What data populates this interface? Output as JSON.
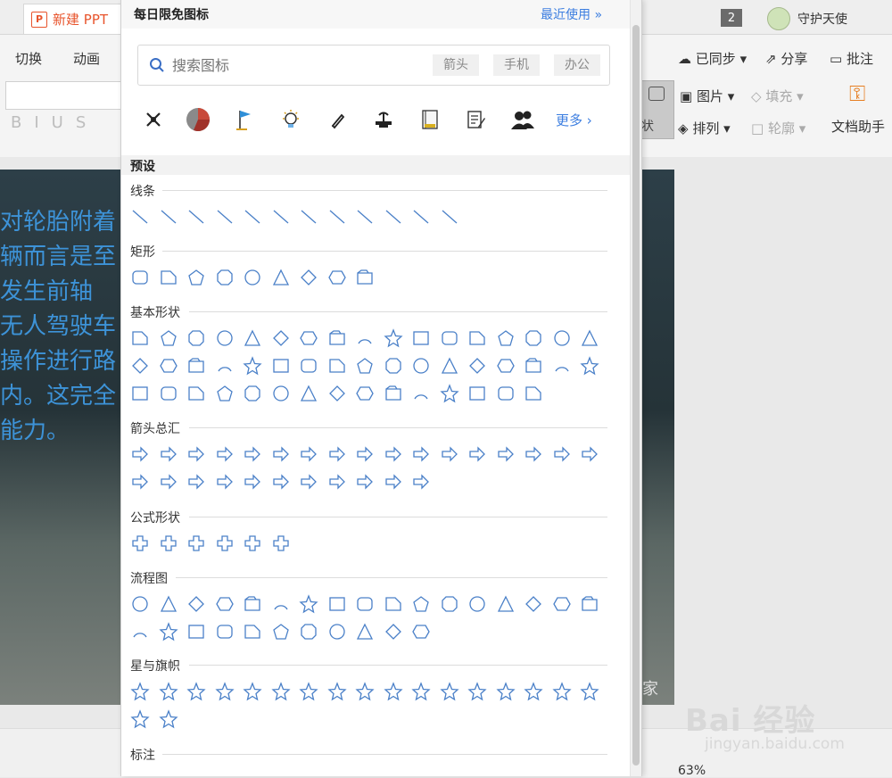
{
  "app": {
    "doc_tab": "新建 PPT",
    "badge": "2",
    "user_name": "守护天使",
    "ribbon_tabs": [
      "切换",
      "动画"
    ],
    "format_buttons": [
      "B",
      "I",
      "U",
      "S"
    ],
    "right_top": [
      "已同步",
      "分享",
      "批注"
    ],
    "right_mid": [
      "图片",
      "填充",
      "文档助手"
    ],
    "right_low": [
      "排列",
      "轮廓"
    ],
    "shape_btn_tail": "状",
    "slide_text": [
      "对轮胎附着",
      "辆而言是至",
      "发生前轴",
      "无人驾驶车",
      "操作进行路",
      "内。这完全",
      "能力。"
    ],
    "watermark_tail": "家",
    "zoom": "63%",
    "baidu": "Bai 经验",
    "baidu_url": "jingyan.baidu.com"
  },
  "popup": {
    "title": "每日限免图标",
    "recent": "最近使用 »",
    "search_placeholder": "搜索图标",
    "chips": [
      "箭头",
      "手机",
      "办公"
    ],
    "icon_row": [
      "satellite-icon",
      "pie-chart-icon",
      "flag-icon",
      "lightbulb-icon",
      "pen-icon",
      "plant-icon",
      "notebook-icon",
      "document-icon",
      "people-icon"
    ],
    "more": "更多 ›",
    "preset": "预设",
    "sections": [
      {
        "name": "线条",
        "count": 12
      },
      {
        "name": "矩形",
        "count": 9
      },
      {
        "name": "基本形状",
        "count": 49
      },
      {
        "name": "箭头总汇",
        "count": 28
      },
      {
        "name": "公式形状",
        "count": 6
      },
      {
        "name": "流程图",
        "count": 28
      },
      {
        "name": "星与旗帜",
        "count": 19
      },
      {
        "name": "标注",
        "count": 0
      }
    ],
    "accent": "#3c7ee0",
    "shape_color": "#4a80c8"
  }
}
